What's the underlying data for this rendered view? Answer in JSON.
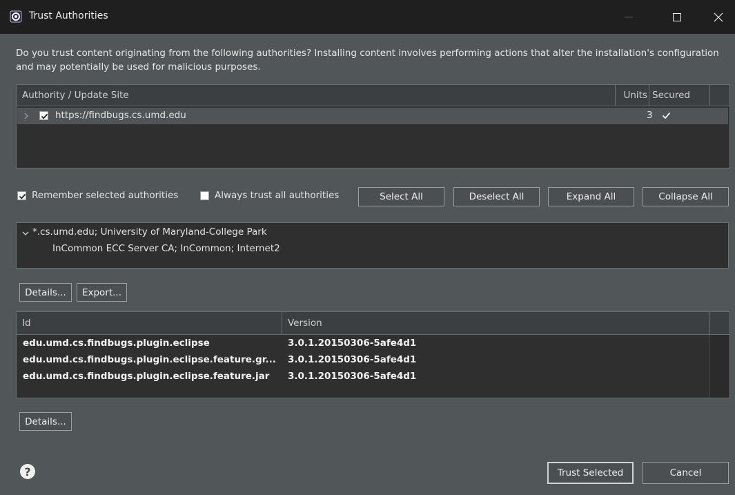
{
  "window": {
    "title": "Trust Authorities",
    "controls": [
      "minimize-icon",
      "maximize-icon",
      "close-icon"
    ]
  },
  "description": "Do you trust content originating from the following authorities?  Installing content involves performing actions that alter the installation's configuration and may potentially be used for malicious purposes.",
  "authority_table": {
    "columns": [
      "Authority / Update Site",
      "Units",
      "Secured"
    ],
    "rows": [
      {
        "site": "https://findbugs.cs.umd.edu",
        "units": "3",
        "secured_icon": "checkmark-icon",
        "checked": true,
        "expanded": false
      }
    ]
  },
  "options": {
    "remember_label": "Remember selected authorities",
    "remember_checked": true,
    "always_trust_label": "Always trust all authorities",
    "always_trust_checked": false
  },
  "buttons": {
    "select_all": "Select All",
    "deselect_all": "Deselect All",
    "expand_all": "Expand All",
    "collapse_all": "Collapse All",
    "details": "Details...",
    "export": "Export...",
    "details2": "Details...",
    "trust_selected": "Trust Selected",
    "cancel": "Cancel"
  },
  "certificate": {
    "subject": "*.cs.umd.edu; University of Maryland-College Park",
    "issuer": "InCommon ECC Server CA; InCommon; Internet2"
  },
  "items_table": {
    "columns": [
      "Id",
      "Version"
    ],
    "rows": [
      {
        "id": "edu.umd.cs.findbugs.plugin.eclipse",
        "version": "3.0.1.20150306-5afe4d1"
      },
      {
        "id": "edu.umd.cs.findbugs.plugin.eclipse.feature.gr...",
        "version": "3.0.1.20150306-5afe4d1"
      },
      {
        "id": "edu.umd.cs.findbugs.plugin.eclipse.feature.jar",
        "version": "3.0.1.20150306-5afe4d1"
      }
    ]
  },
  "colors": {
    "dialog_bg": "#515658",
    "titlebar_bg": "#1f1f1f",
    "table_bg": "#2f2f2f",
    "selected_row": "#515456"
  }
}
